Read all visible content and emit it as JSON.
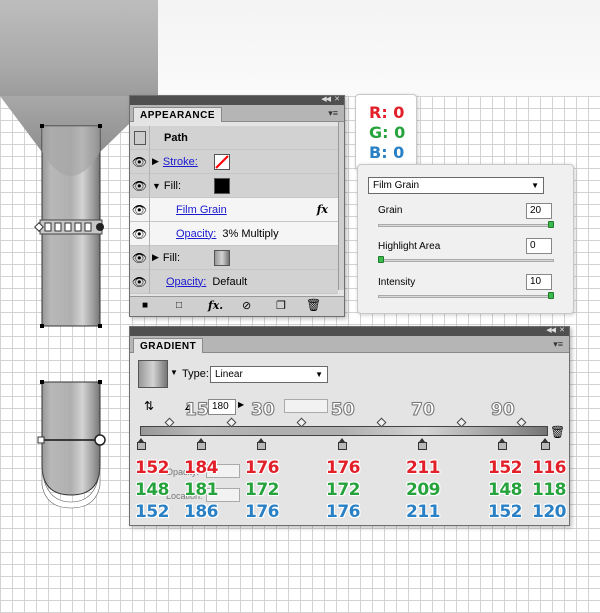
{
  "appearance": {
    "tab": "APPEARANCE",
    "path_label": "Path",
    "stroke_label": "Stroke:",
    "fill_label": "Fill:",
    "film_grain_label": "Film Grain",
    "fx_label": "fx",
    "opacity_label": "Opacity:",
    "opacity_value_fx": "3% Multiply",
    "fill2_label": "Fill:",
    "opacity_value_default": "Default",
    "colors": {
      "fill1": "#000000",
      "stroke_none": "#ff0000"
    }
  },
  "rgb": {
    "r": "R: 0",
    "g": "G: 0",
    "b": "B: 0"
  },
  "film_grain": {
    "effect_select": "Film Grain",
    "grain_label": "Grain",
    "grain_value": "20",
    "highlight_label": "Highlight Area",
    "highlight_value": "0",
    "intensity_label": "Intensity",
    "intensity_value": "10",
    "grain_level": 1.0,
    "highlight_level": 0.0,
    "intensity_level": 1.0
  },
  "gradient": {
    "tab": "GRADIENT",
    "type_label": "Type:",
    "type_value": "Linear",
    "angle_value": "180",
    "location_labels": [
      "15",
      "30",
      "50",
      "70",
      "90"
    ],
    "stops_r": [
      "152",
      "184",
      "176",
      "176",
      "211",
      "152",
      "116"
    ],
    "stops_g": [
      "148",
      "181",
      "172",
      "172",
      "209",
      "148",
      "118"
    ],
    "stops_b": [
      "152",
      "186",
      "176",
      "176",
      "211",
      "152",
      "120"
    ],
    "ghost_opacity": "Opacity:",
    "ghost_location": "Location:"
  }
}
